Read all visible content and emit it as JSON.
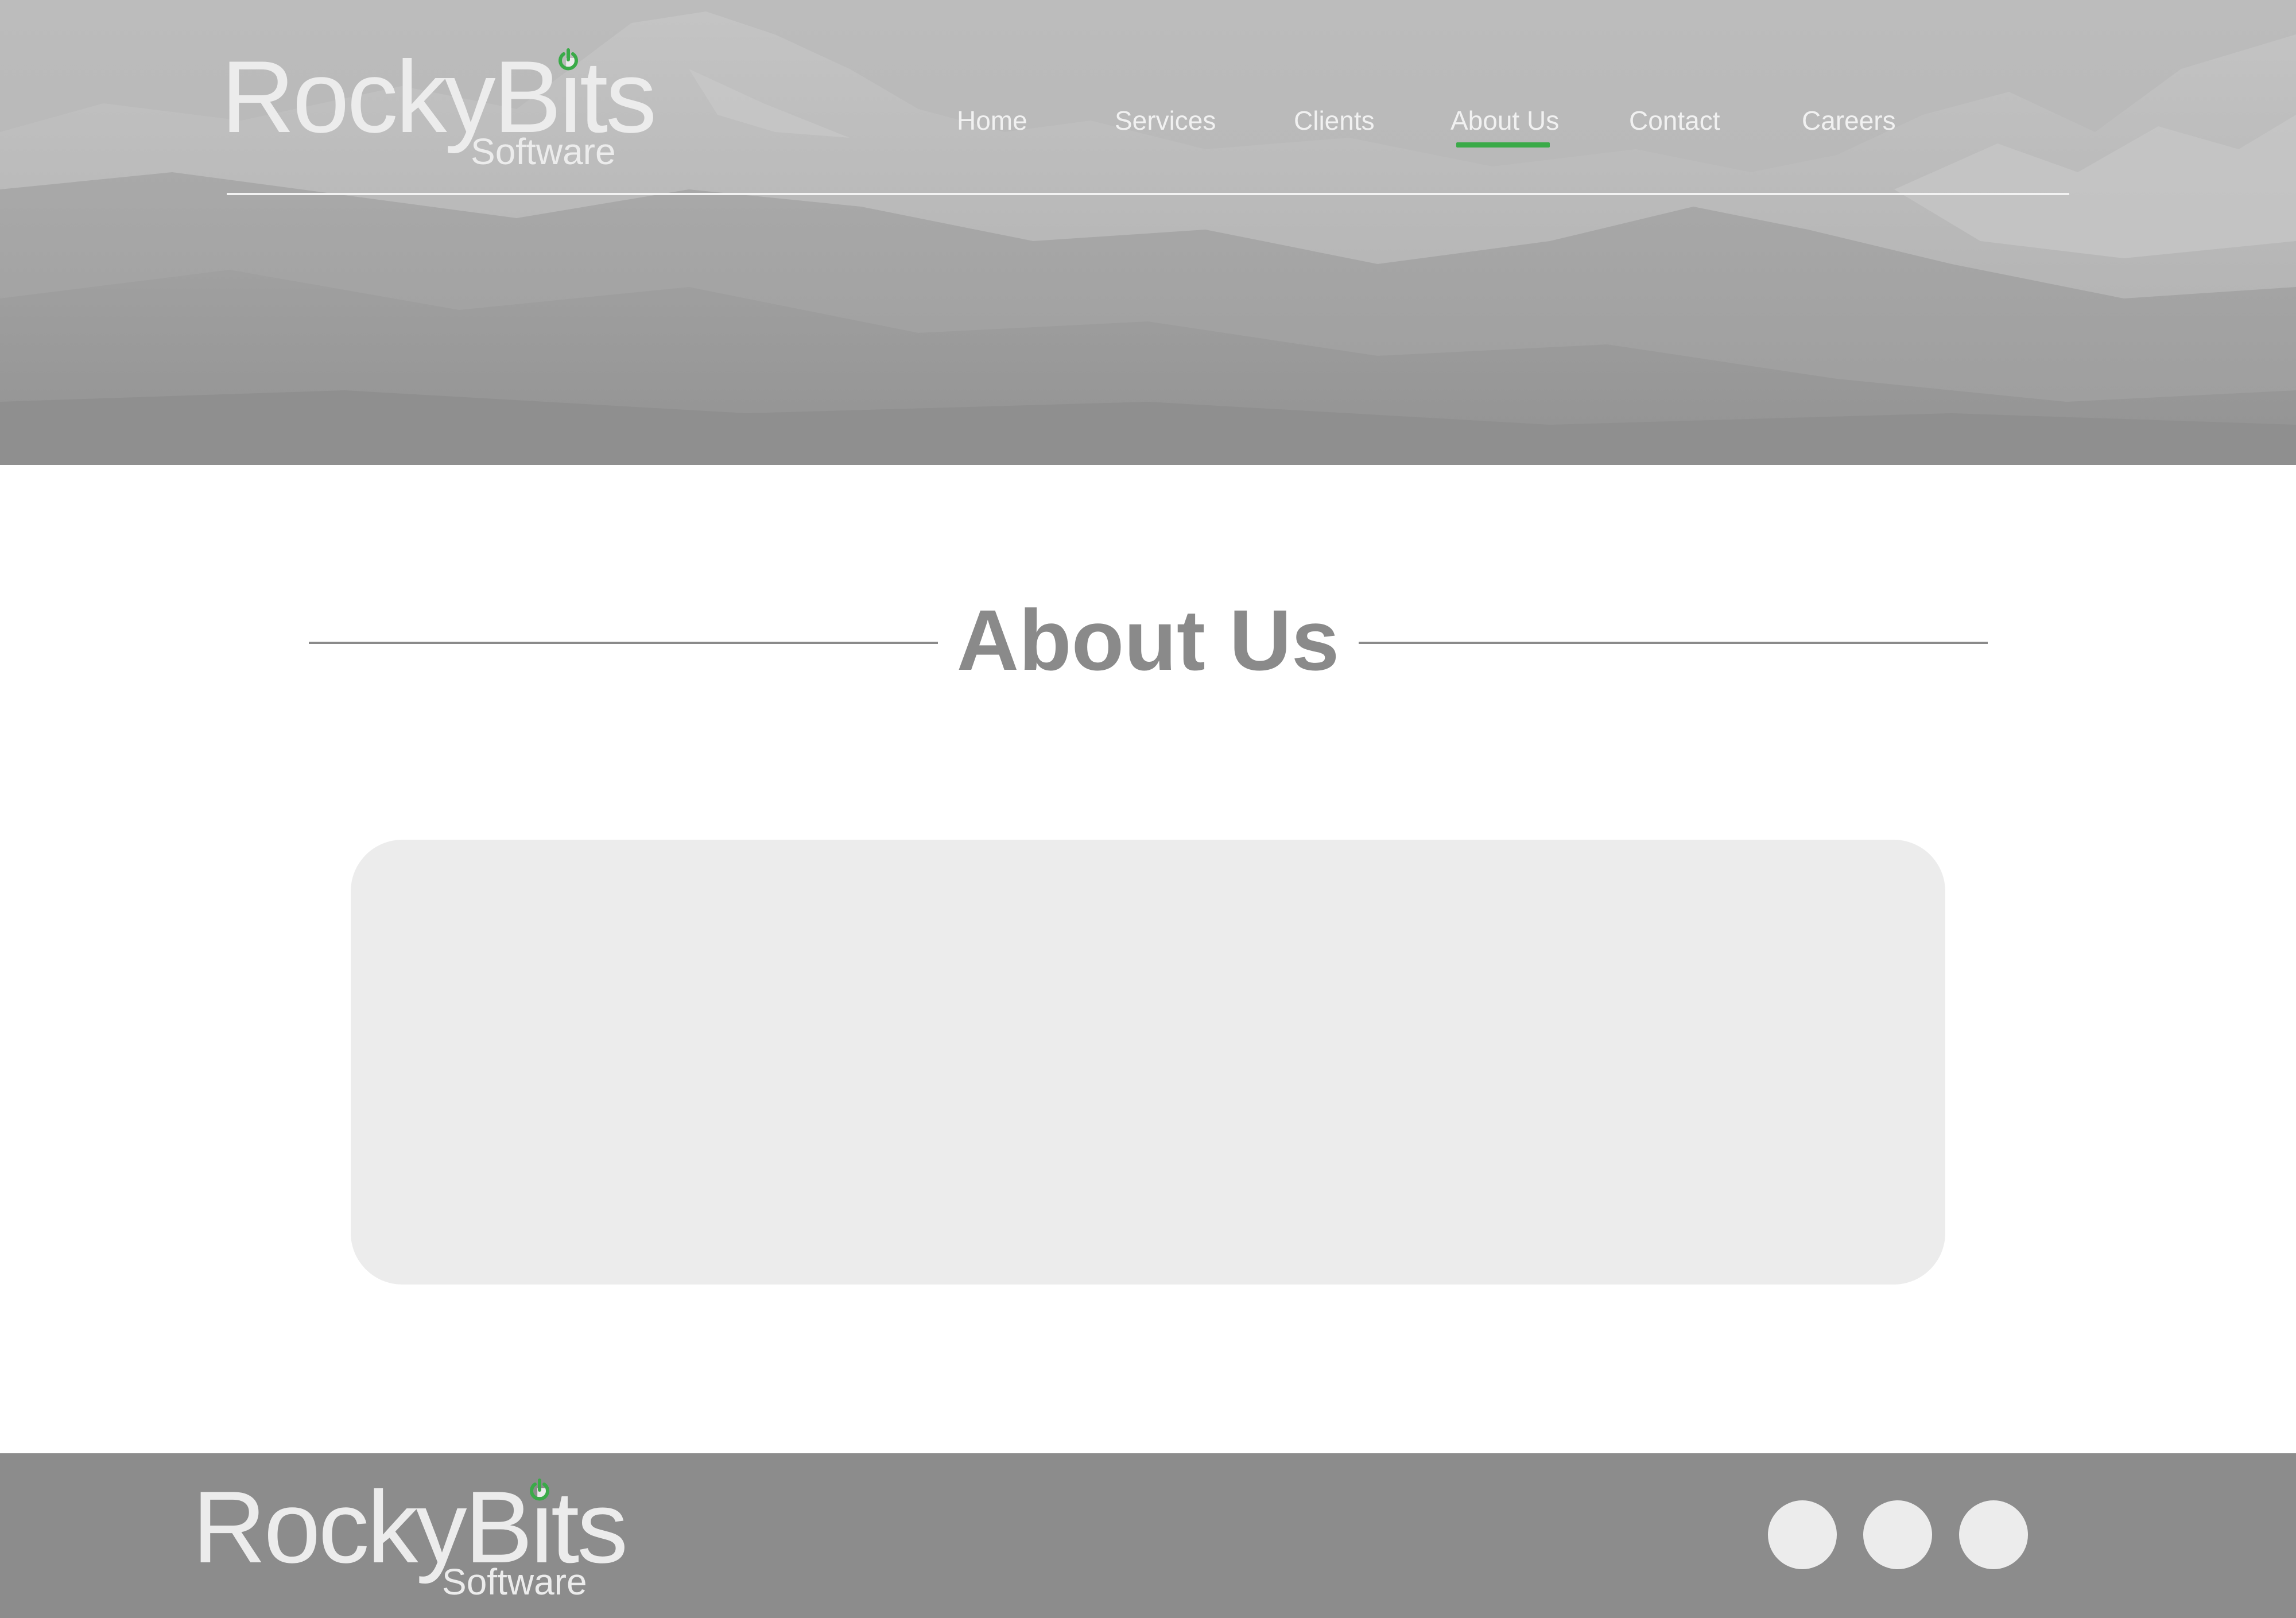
{
  "header": {
    "logo": {
      "brand": "RockyBits",
      "sub": "Software",
      "accent_color": "#3aaa48"
    },
    "nav": [
      {
        "label": "Home"
      },
      {
        "label": "Services"
      },
      {
        "label": "Clients"
      },
      {
        "label": "About Us",
        "active": true
      },
      {
        "label": "Contact"
      },
      {
        "label": "Careers"
      }
    ],
    "active_indicator_color": "#3aaa48"
  },
  "main": {
    "title": "About Us"
  },
  "footer": {
    "logo": {
      "brand": "RockyBits",
      "sub": "Software"
    },
    "social": [
      {
        "icon": "social-icon-placeholder"
      },
      {
        "icon": "social-icon-placeholder"
      },
      {
        "icon": "social-icon-placeholder"
      }
    ]
  },
  "colors": {
    "accent": "#3aaa48",
    "hero_overlay": "#b9b9b9",
    "title_gray": "#8a8a8a",
    "panel": "#ececec",
    "footer_bg": "#8c8c8c"
  }
}
